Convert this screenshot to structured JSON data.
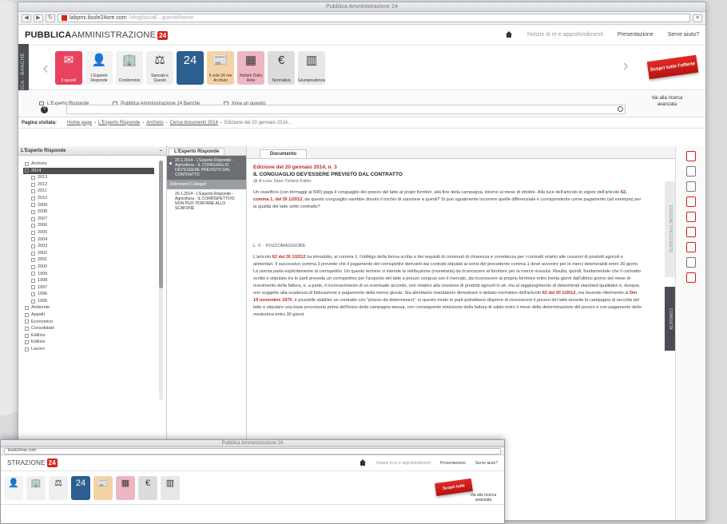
{
  "window": {
    "title": "Pubblica Amministrazione 24",
    "url_host": "labpmi.ilsole24ore.com",
    "url_path": "/sfoglia/cid/...quesiti/home"
  },
  "brand": {
    "logo_bold": "PUBBLICA",
    "logo_thin": "AMMINISTRAZIONE",
    "logo_badge": "24"
  },
  "toplinks": [
    {
      "label": "Notizie di re e approfondimenti"
    },
    {
      "label": "Presentazione"
    },
    {
      "label": "Serve aiuto?"
    }
  ],
  "side_tab": "PUBBLICA - BANCHE",
  "tiles": [
    {
      "label": "Il quesiti",
      "glyph": "✉"
    },
    {
      "label": "L'Esperto Risponde",
      "glyph": "👤"
    },
    {
      "label": "Condominio",
      "glyph": "🏢"
    },
    {
      "label": "Speciali e Quesiti",
      "glyph": "⚖"
    },
    {
      "label": "24",
      "glyph": "24"
    },
    {
      "label": "Il sole 24 ore Archivio",
      "glyph": "📰"
    },
    {
      "label": "Notizie Dalla Rete",
      "glyph": "▦"
    },
    {
      "label": "Normativa",
      "glyph": "€"
    },
    {
      "label": "Giurisprudenza",
      "glyph": "▥"
    }
  ],
  "promo": "Scopri tutte l'offerte",
  "quickbar": [
    {
      "label": "L'Esperto Risponde"
    },
    {
      "label": "Pubblica Amministrazione 24 Banche"
    },
    {
      "label": "Invia un quesito"
    }
  ],
  "ricerca_link": "Vai alla ricerca avanzata",
  "breadcrumb": {
    "label": "Pagina visitata:",
    "items": [
      "Home page",
      "L'Esperto Risponde",
      "Archivio",
      "Cerca documenti 2014",
      "Edizione del 20 gennaio 2014..."
    ]
  },
  "left_pane": {
    "title": "L'Esperto Risponde",
    "tree": [
      {
        "label": "Archivio",
        "level": "cat"
      },
      {
        "label": "2014",
        "level": "child",
        "selected": true
      },
      {
        "label": "2013",
        "level": "child"
      },
      {
        "label": "2012",
        "level": "child"
      },
      {
        "label": "2011",
        "level": "child"
      },
      {
        "label": "2010",
        "level": "child"
      },
      {
        "label": "2009",
        "level": "child"
      },
      {
        "label": "2008",
        "level": "child"
      },
      {
        "label": "2007",
        "level": "child"
      },
      {
        "label": "2006",
        "level": "child"
      },
      {
        "label": "2005",
        "level": "child"
      },
      {
        "label": "2004",
        "level": "child"
      },
      {
        "label": "2003",
        "level": "child"
      },
      {
        "label": "2002",
        "level": "child"
      },
      {
        "label": "2001",
        "level": "child"
      },
      {
        "label": "2000",
        "level": "child"
      },
      {
        "label": "1999",
        "level": "child"
      },
      {
        "label": "1998",
        "level": "child"
      },
      {
        "label": "1997",
        "level": "child"
      },
      {
        "label": "1996",
        "level": "child"
      },
      {
        "label": "1995",
        "level": "child"
      },
      {
        "label": "Ambiente",
        "level": "cat"
      },
      {
        "label": "Appalti",
        "level": "cat"
      },
      {
        "label": "Economico",
        "level": "cat"
      },
      {
        "label": "Consolidate",
        "level": "cat"
      },
      {
        "label": "Edilizia",
        "level": "cat"
      },
      {
        "label": "Edilizia",
        "level": "cat"
      },
      {
        "label": "Lavoro",
        "level": "cat"
      }
    ]
  },
  "mid_pane": {
    "tab": "L'Esperto Risponde",
    "items": [
      {
        "text": "20.1.2014 - L'Esperto Risponde - Agricoltura - IL CONGUAGLIO DEV'ESSERE PREVISTO DAL CONTRATTO",
        "kind": "active"
      },
      {
        "text": "Riferimenti Collegati",
        "kind": "sub"
      },
      {
        "text": "20.1.2014 - L'Esperto Risponde - Agricoltura - IL CORRISPETTIVO NON PUO' PORTARE ALLO SCAFONE",
        "kind": "plain"
      }
    ]
  },
  "document": {
    "tab": "Documento",
    "date_line": "Edizione del 20 gennaio 2014, n. 3",
    "title": "IL CONGUAGLIO DEV'ESSERE PREVISTO DAL CONTRATTO",
    "author": "@ A cura: Gian Tiziano Fabio",
    "p1": "Un caseificio (con formaggi al 500) paga il conguaglio del prezzo del latte ai propri fornitori, alla fine della campagna, intorno al mese di ottobre. Alla luce dell'articolo in vigore dell'articolo",
    "p1_red": "62, comma 1, del Dl 1/2012",
    "p1_tail": ", da questo conguaglio sarebbe dovuto il rischio di sanzione a questi? Si può ugualmente incorrere quelle differenziale e corrispondente come pagamento (ad esempio) per la qualità del latte sotto contratto?",
    "signature": "L. F. - POZZOMAGGIORE",
    "p2": "L'articolo",
    "p2_red": "62 del Dl 1/2012",
    "p2_tail": " ha introdotto, al comma 1, l'obbligo della forma scritta e dei requisiti di contenuti di chiarezza e correttezza per i contratti relativi alle cessioni di prodotti agricoli e alimentari. Il successivo comma 3 prevede che il pagamento dei corrispettivi derivanti dai contratti stipulati ai sensi del precedente comma 1 deve avvenire per le merci deteriorabili entro 30 giorni. La norma parla esplicitamente di corrispettivi. Un questo termine si intende la retribuzione (monetaria) da riconoscere al fornitore per la merce ricevuta. Risulta, quindi, fondamentale che il contratto scritto e stipulato tra le parti preveda un corrispettivo per l'acquisto del latte a prezzo congruo con il mercato, da riconoscere al proprio fornitore entro trenta giorni dall'ultimo giorno del mese di ricevimento della fattura, e, a parte, il riconoscimento di un eventuale acconto, non relativo alla cessione di prodotti agricoli in sé, ma al raggiungimento di determinati standard qualitativi e, dunque, non soggetto alla scadenza di fatturazione e pagamento della merce giunta. Sia altrettanto mandatorio dimostrare e dettato normativo dell'articolo",
    "p2_red2": "62 del Dl 1/2012",
    "p2_tail2": ", ma facendo riferimento al",
    "p2_red3": "Dm 19 novembre 1970",
    "p2_tail3": ", è possibile stabilire un contratto con \"prezzo da determinarsi\": in questo modo le parti potrebbero disporre di riconoscere il prezzo del latte durante la campagna di raccolta del latte e stipulare una base provvisoria prima dell'inizio della campagna stessa, con conseguente emissione della fattura di saldo entro il mese della determinazione del prezzo e con pagamento della medesima entro 30 giorni."
  },
  "rail": {
    "side_label": "EDIZIONE PRECEDENTE",
    "dark_label": "CONSULTA"
  },
  "mini": {
    "title": "Pubblica Amministrazione 24",
    "url": "ilsole24ore.com",
    "logo": "STRAZIONE",
    "toplinks": [
      "Notizie di re e approfondimenti",
      "Presentazione",
      "Serve aiuto?"
    ],
    "promo": "Scopri tutte l'offerte",
    "help": "Vai alla ricerca avanzata"
  }
}
